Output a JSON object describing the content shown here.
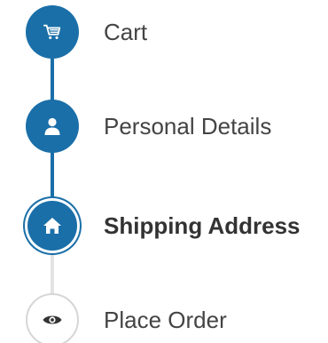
{
  "steps": [
    {
      "label": "Cart",
      "icon": "cart-icon",
      "status": "completed"
    },
    {
      "label": "Personal Details",
      "icon": "user-icon",
      "status": "completed"
    },
    {
      "label": "Shipping Address",
      "icon": "home-icon",
      "status": "active"
    },
    {
      "label": "Place Order",
      "icon": "eye-icon",
      "status": "pending"
    }
  ],
  "colors": {
    "accent": "#1a6fa8",
    "pending_border": "#d6d6d6",
    "pending_line": "#e3e3e3",
    "text": "#444444"
  }
}
